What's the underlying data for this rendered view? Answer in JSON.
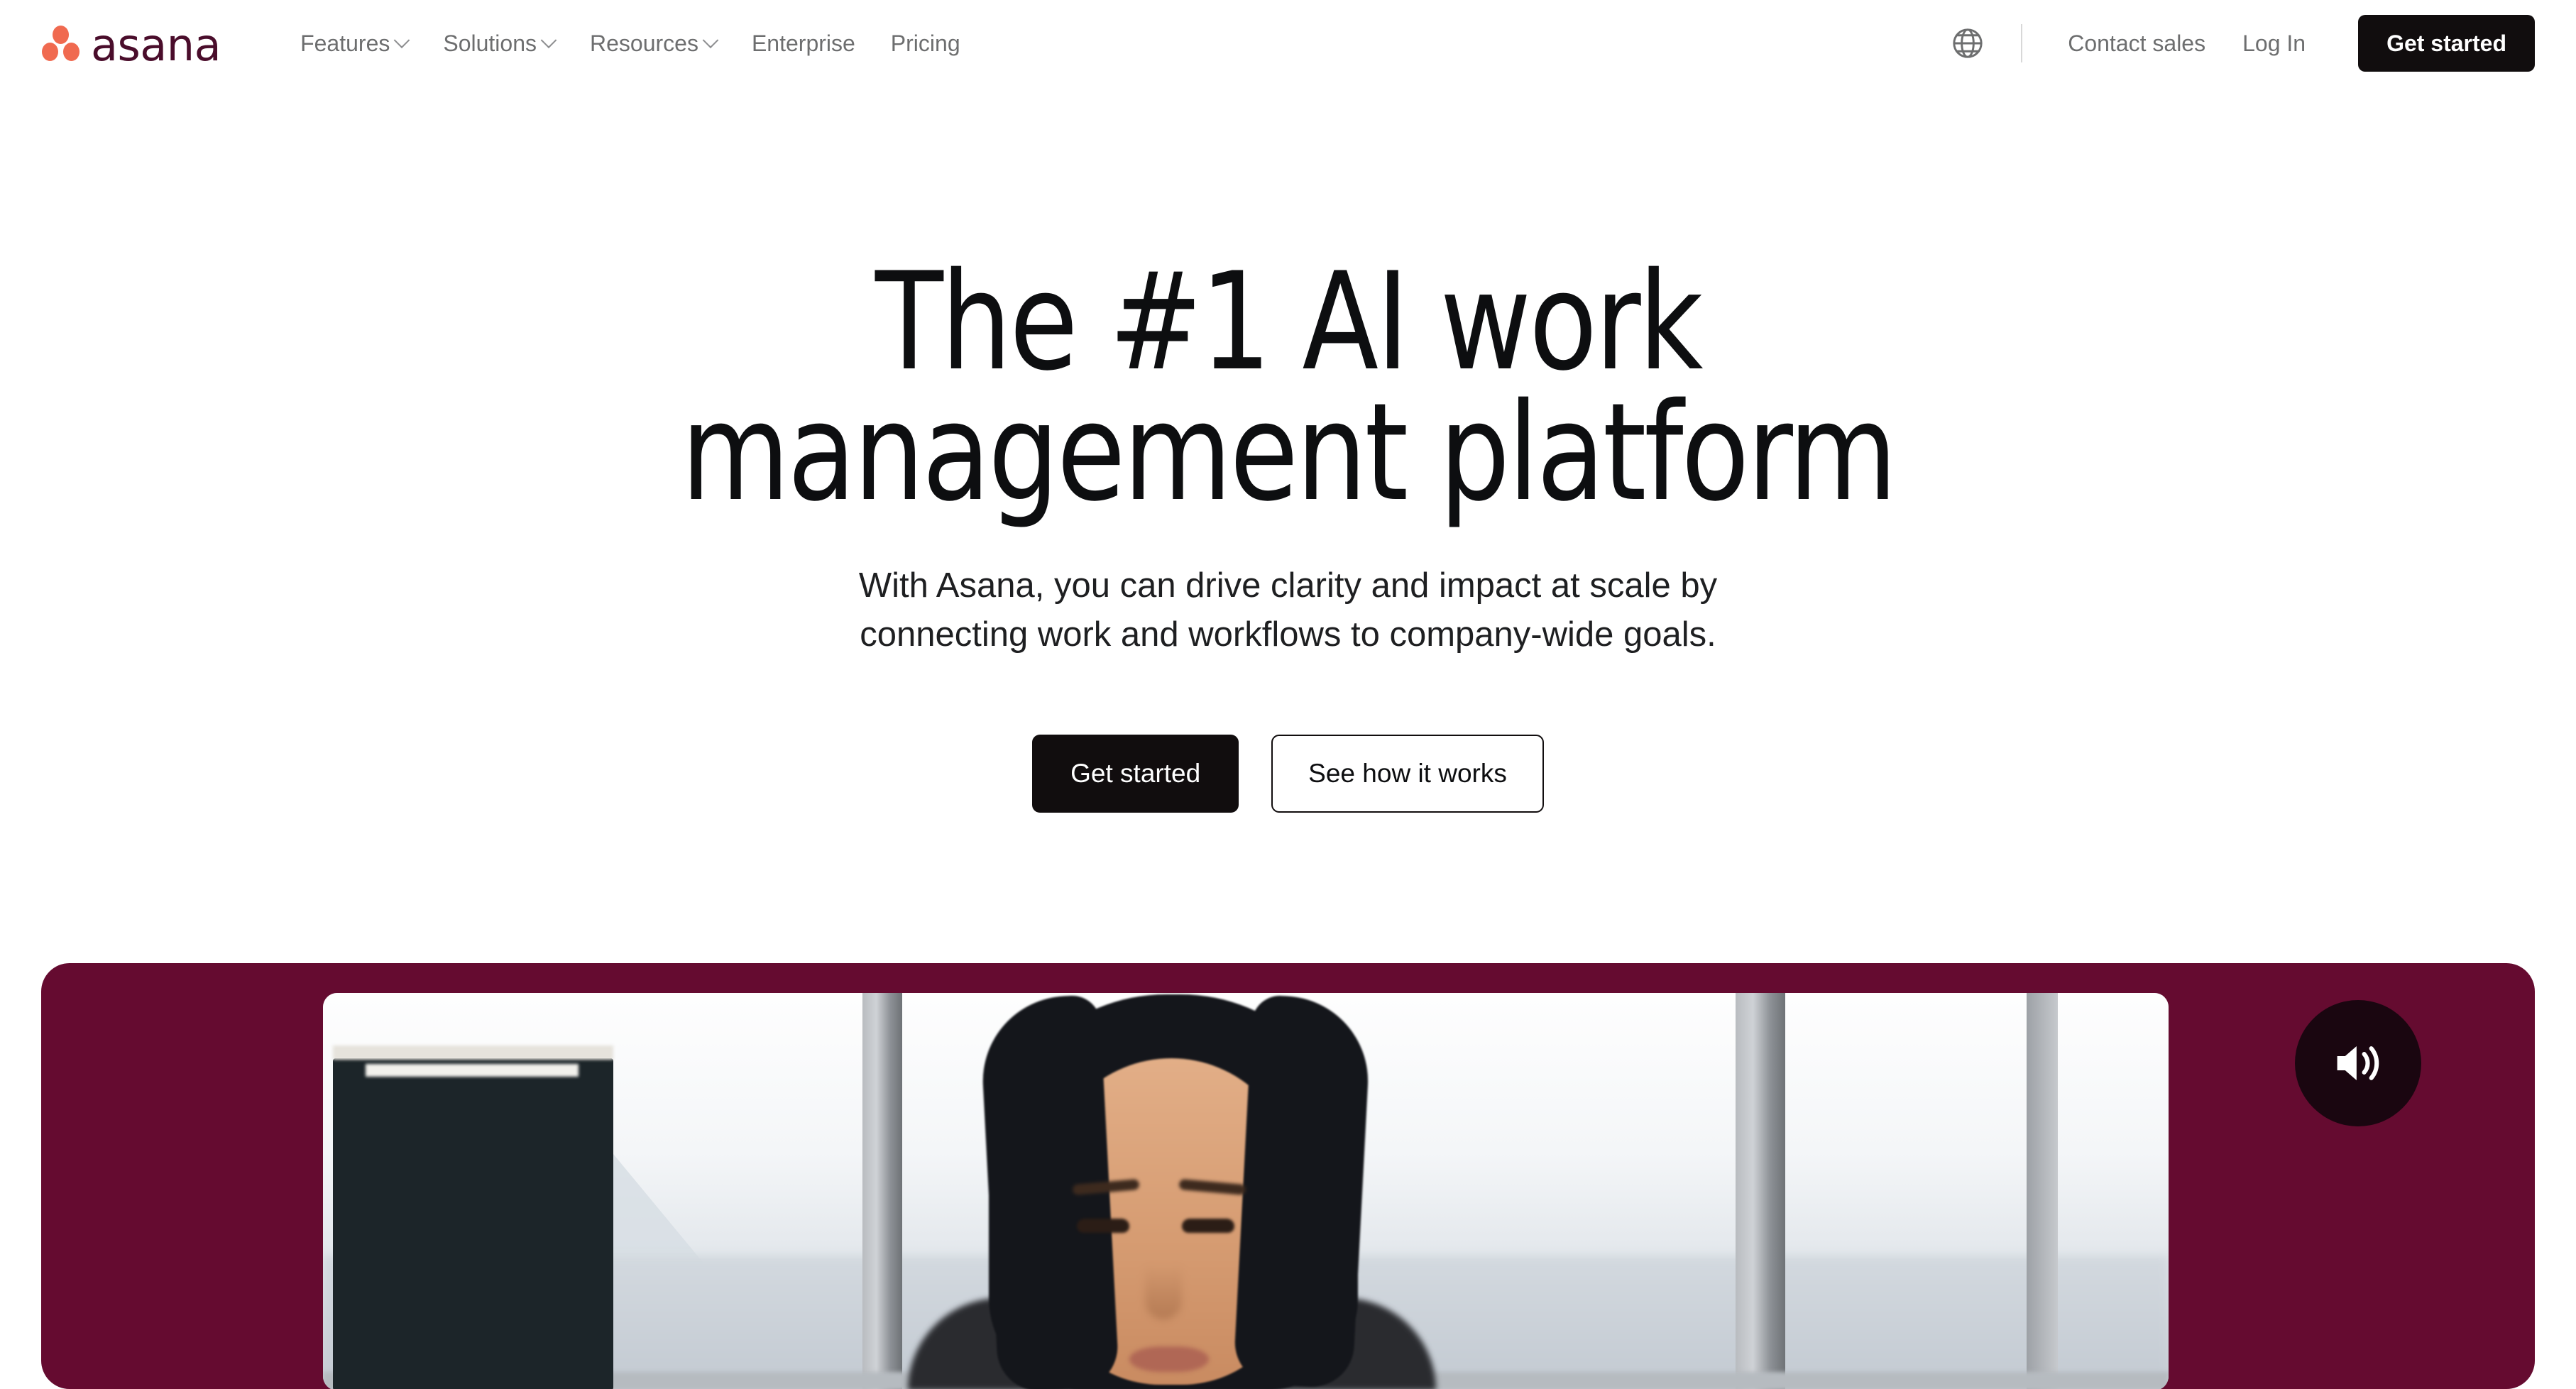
{
  "brand": {
    "name": "asana",
    "logo_dot_color": "#f06a50",
    "logo_word_color": "#4a0d2b"
  },
  "header": {
    "nav": [
      {
        "label": "Features",
        "has_dropdown": true,
        "icon": "chevron-down-icon"
      },
      {
        "label": "Solutions",
        "has_dropdown": true,
        "icon": "chevron-down-icon"
      },
      {
        "label": "Resources",
        "has_dropdown": true,
        "icon": "chevron-down-icon"
      },
      {
        "label": "Enterprise",
        "has_dropdown": false,
        "icon": ""
      },
      {
        "label": "Pricing",
        "has_dropdown": false,
        "icon": ""
      }
    ],
    "language_icon": "globe-icon",
    "contact_sales": "Contact sales",
    "log_in": "Log In",
    "get_started": "Get started"
  },
  "hero": {
    "title_line1": "The #1 AI work",
    "title_line2": "management platform",
    "subtitle_line1": "With Asana, you can drive clarity and impact at scale by",
    "subtitle_line2": "connecting work and workflows to company-wide goals.",
    "cta_primary": "Get started",
    "cta_secondary": "See how it works"
  },
  "video": {
    "banner_color": "#650b30",
    "volume_icon": "volume-on-icon",
    "volume_state": "unmuted"
  },
  "colors": {
    "accent_coral": "#f06a50",
    "brand_maroon": "#4a0d2b",
    "banner_maroon": "#650b30",
    "button_black": "#110d0e",
    "nav_text": "#6d6e6f",
    "heading_text": "#0d0e10"
  }
}
